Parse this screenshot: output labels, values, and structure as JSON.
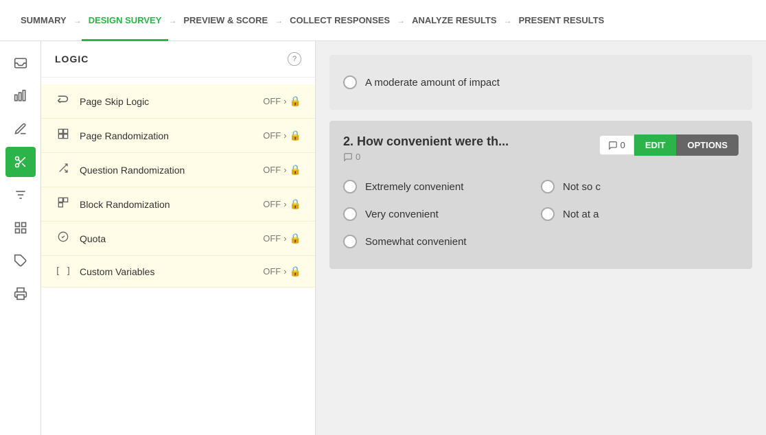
{
  "nav": {
    "items": [
      {
        "label": "SUMMARY",
        "active": false
      },
      {
        "label": "DESIGN SURVEY",
        "active": true
      },
      {
        "label": "PREVIEW & SCORE",
        "active": false
      },
      {
        "label": "COLLECT RESPONSES",
        "active": false
      },
      {
        "label": "ANALYZE RESULTS",
        "active": false
      },
      {
        "label": "PRESENT RESULTS",
        "active": false
      }
    ]
  },
  "icons": [
    {
      "name": "inbox-icon",
      "symbol": "⊟"
    },
    {
      "name": "chart-icon",
      "symbol": "▤"
    },
    {
      "name": "pen-icon",
      "symbol": "✎"
    },
    {
      "name": "logic-icon",
      "symbol": "✂"
    },
    {
      "name": "filter-icon",
      "symbol": "⊞"
    },
    {
      "name": "grid-icon",
      "symbol": "⊡"
    },
    {
      "name": "tag-icon",
      "symbol": "⬡"
    },
    {
      "name": "print-icon",
      "symbol": "⎙"
    }
  ],
  "logic": {
    "title": "LOGIC",
    "help_label": "?",
    "items": [
      {
        "id": "page-skip-logic",
        "icon": "↩",
        "label": "Page Skip Logic",
        "status": "OFF",
        "locked": true
      },
      {
        "id": "page-randomization",
        "icon": "⊠",
        "label": "Page Randomization",
        "status": "OFF",
        "locked": true
      },
      {
        "id": "question-randomization",
        "icon": "⇄",
        "label": "Question Randomization",
        "status": "OFF",
        "locked": true
      },
      {
        "id": "block-randomization",
        "icon": "⊠",
        "label": "Block Randomization",
        "status": "OFF",
        "locked": true
      },
      {
        "id": "quota",
        "icon": "✓",
        "label": "Quota",
        "status": "OFF",
        "locked": true
      },
      {
        "id": "custom-variables",
        "icon": "[]",
        "label": "Custom Variables",
        "status": "OFF",
        "locked": true
      }
    ]
  },
  "content": {
    "q1_option": "A moderate amount of impact",
    "q2": {
      "number": "2.",
      "title": "How convenient were th",
      "title_suffix": "...",
      "comment_count": 0,
      "comment_bubble_count": 0,
      "edit_label": "EDIT",
      "options_label": "OPTIONS",
      "options": [
        {
          "text": "Extremely convenient",
          "col": 0
        },
        {
          "text": "Not so c",
          "col": 1
        },
        {
          "text": "Very convenient",
          "col": 0
        },
        {
          "text": "Not at a",
          "col": 1
        },
        {
          "text": "Somewhat convenient",
          "col": 0
        }
      ]
    }
  }
}
